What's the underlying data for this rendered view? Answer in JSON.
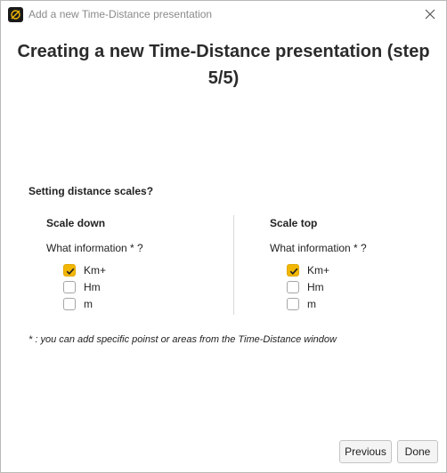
{
  "window": {
    "title": "Add a new Time-Distance presentation"
  },
  "heading": "Creating a new Time-Distance presentation (step 5/5)",
  "section_title": "Setting distance scales?",
  "scale_down": {
    "title": "Scale down",
    "question": "What information * ?",
    "options": [
      {
        "label": "Km+",
        "checked": true
      },
      {
        "label": "Hm",
        "checked": false
      },
      {
        "label": "m",
        "checked": false
      }
    ]
  },
  "scale_top": {
    "title": "Scale top",
    "question": "What information * ?",
    "options": [
      {
        "label": "Km+",
        "checked": true
      },
      {
        "label": "Hm",
        "checked": false
      },
      {
        "label": "m",
        "checked": false
      }
    ]
  },
  "footnote": "* : you can add specific poinst or areas from the Time-Distance window",
  "buttons": {
    "previous": "Previous",
    "done": "Done"
  },
  "colors": {
    "accent_checked": "#f2b705",
    "title_gray": "#8a8a8a"
  },
  "icons": {
    "app": "app-logo-icon",
    "close": "close-icon",
    "check": "checkmark-icon"
  }
}
